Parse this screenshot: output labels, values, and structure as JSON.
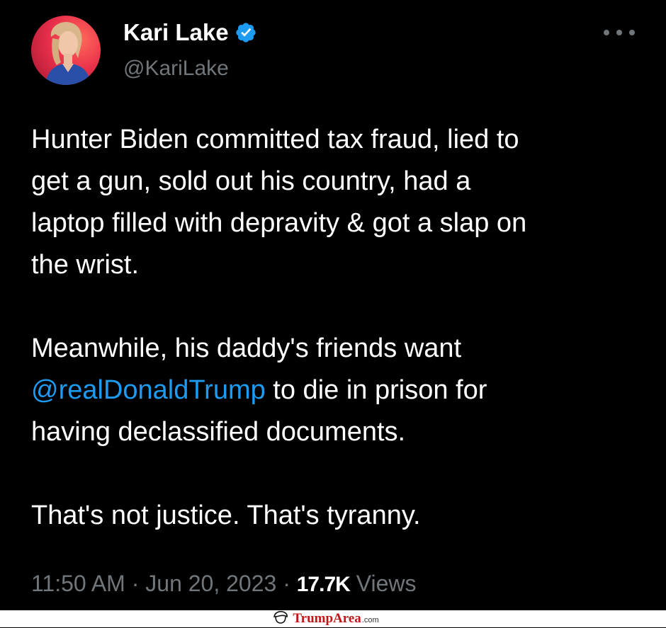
{
  "author": {
    "display_name": "Kari Lake",
    "handle": "@KariLake",
    "verified": true,
    "verified_color": "#1d9bf0"
  },
  "tweet": {
    "para1": "Hunter Biden committed tax fraud, lied to\nget a gun, sold out his country, had a\nlaptop filled with depravity & got a slap on\nthe wrist.",
    "para2_before": "Meanwhile, his daddy's friends want\n",
    "mention": "@realDonaldTrump",
    "para2_after": " to die in prison for\nhaving declassified documents.",
    "para3": "That's not justice. That's tyranny.",
    "mention_color": "#1d9bf0"
  },
  "meta": {
    "time": "11:50 AM",
    "separator": "·",
    "date": "Jun 20, 2023",
    "views_count": "17.7K",
    "views_label": "Views"
  },
  "icons": {
    "more": "more-horizontal-icon",
    "verified": "verified-badge-icon",
    "watermark": "trump-hair-icon"
  },
  "watermark": {
    "brand": "TrumpArea",
    "suffix": ".com"
  }
}
